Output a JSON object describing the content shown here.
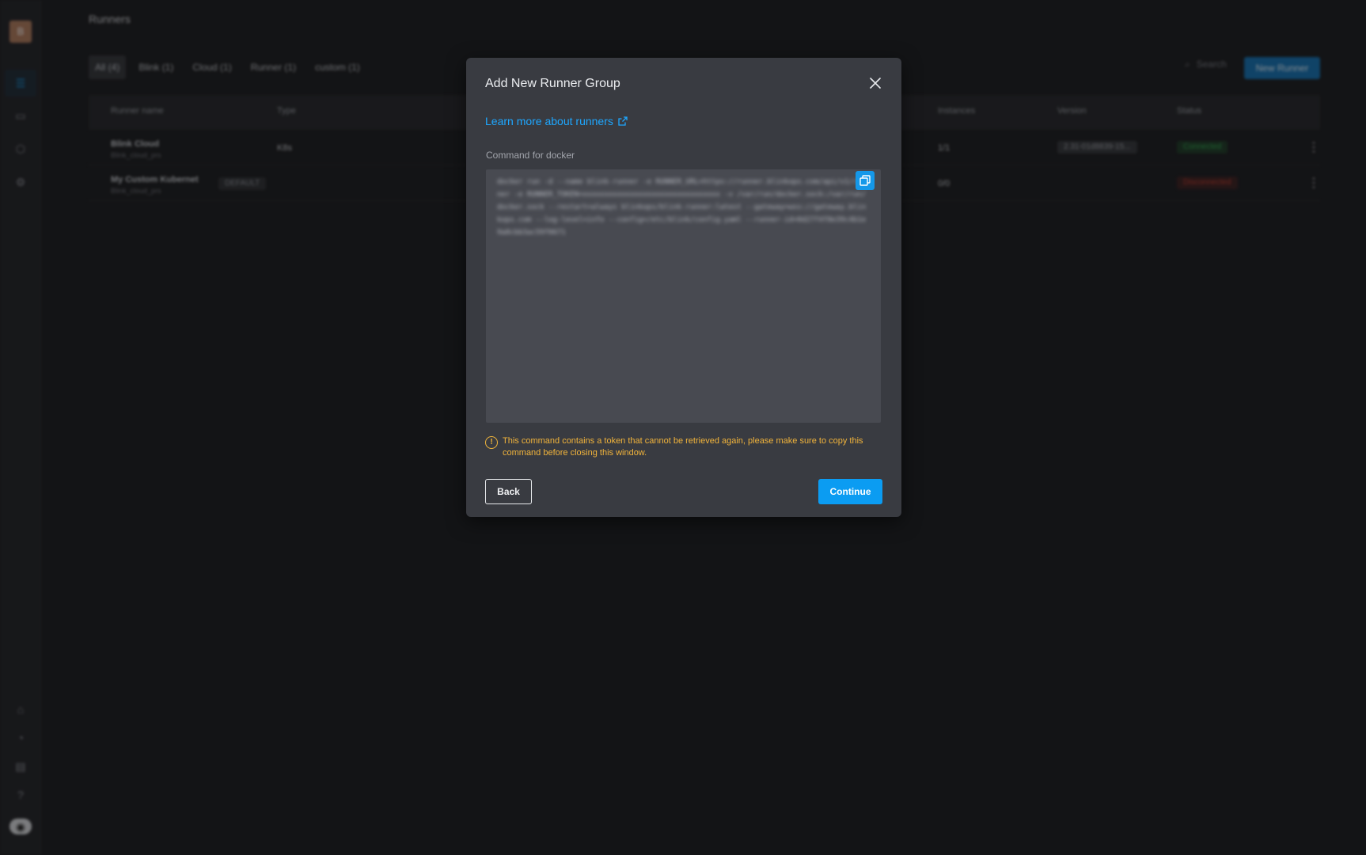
{
  "background": {
    "page_title": "Runners",
    "filters": [
      "All (4)",
      "Blink (1)",
      "Cloud (1)",
      "Runner (1)",
      "custom (1)"
    ],
    "search_placeholder": "Search",
    "new_runner_label": "New Runner",
    "columns": {
      "name": "Runner name",
      "type": "Type",
      "instances": "Instances",
      "version": "Version",
      "status": "Status"
    },
    "rows": [
      {
        "name": "Blink Cloud",
        "sub": "Blink_cloud_prs",
        "type": "K8s",
        "instances": "1/1",
        "version": "2.31-01d8839-15...",
        "status": "Connected"
      },
      {
        "name": "My Custom Kubernet",
        "sub": "Blink_cloud_prs",
        "badge": "DEFAULT",
        "type": "",
        "instances": "0/0",
        "version": "",
        "status": "Disconnected"
      }
    ]
  },
  "modal": {
    "title": "Add New Runner Group",
    "learn_more": "Learn more about runners",
    "field_label": "Command for docker",
    "command": "docker run -d --name blink-runner -e RUNNER_URL=https://runner.blinkops.com/api/v1/runner -e RUNNER_TOKEN=xxxxxxxxxxxxxxxxxxxxxxxxxxxxxxxx -v /var/run/docker.sock:/var/run/docker.sock --restart=always blinkops/blink-runner:latest --gateway=wss://gateway.blinkops.com --log-level=info --config=/etc/blink/config.yaml --runner-id=0d27f4f8e39c4b1e9a8cbb3ac59f0671",
    "warning": "This command contains a token that cannot be retrieved again, please make sure to copy this command before closing this window.",
    "back_label": "Back",
    "continue_label": "Continue"
  },
  "colors": {
    "accent": "#0b9cf2",
    "link": "#1ea7ff",
    "warning": "#f2b43b",
    "connected": "#2fa84f",
    "disconnected": "#c0392b"
  },
  "icons": {
    "close": "close-icon",
    "external_link": "external-link-icon",
    "copy": "copy-icon",
    "warning": "warning-icon"
  }
}
